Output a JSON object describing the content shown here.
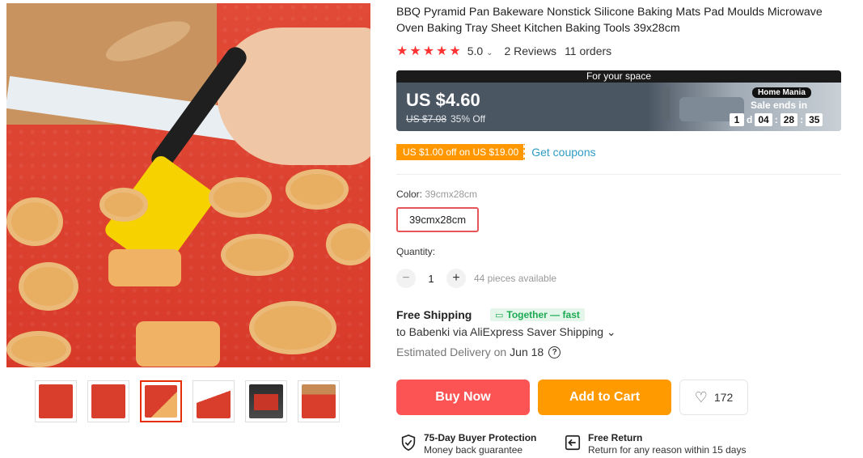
{
  "product": {
    "title": "BBQ Pyramid Pan Bakeware Nonstick Silicone Baking Mats Pad Moulds Microwave Oven Baking Tray Sheet Kitchen Baking Tools 39x28cm",
    "rating": "5.0",
    "rating_stars": 5,
    "reviews": "2 Reviews",
    "orders": "11 orders"
  },
  "promo": {
    "header": "For your space",
    "price": "US $4.60",
    "original_price": "US $7.08",
    "discount": "35% Off",
    "store_badge": "Home Mania",
    "sale_ends_label": "Sale ends in",
    "countdown": {
      "days": "1",
      "days_suffix": "d",
      "hours": "04",
      "minutes": "28",
      "seconds": "35"
    }
  },
  "coupon": {
    "tag": "US $1.00 off on US $19.00",
    "link": "Get coupons"
  },
  "options": {
    "color_label": "Color:",
    "color_value": "39cmx28cm",
    "selected": "39cmx28cm"
  },
  "quantity": {
    "label": "Quantity:",
    "minus": "−",
    "value": "1",
    "plus": "+",
    "available": "44 pieces available"
  },
  "shipping": {
    "title": "Free Shipping",
    "badge": "Together — fast",
    "detail": "to Babenki via AliExpress Saver Shipping ⌄",
    "delivery_label": "Estimated Delivery on",
    "delivery_date": "Jun 18",
    "help": "?"
  },
  "actions": {
    "buy_now": "Buy Now",
    "add_to_cart": "Add to Cart",
    "wishlist_count": "172"
  },
  "guarantees": [
    {
      "title": "75-Day Buyer Protection",
      "subtitle": "Money back guarantee",
      "icon": "shield-check-icon"
    },
    {
      "title": "Free Return",
      "subtitle": "Return for any reason within 15 days",
      "icon": "return-icon"
    }
  ],
  "colors": {
    "accent_red": "#fc5454",
    "accent_orange": "#ff9a00",
    "coupon_link": "#2e9cc3",
    "star": "#ff3333"
  }
}
